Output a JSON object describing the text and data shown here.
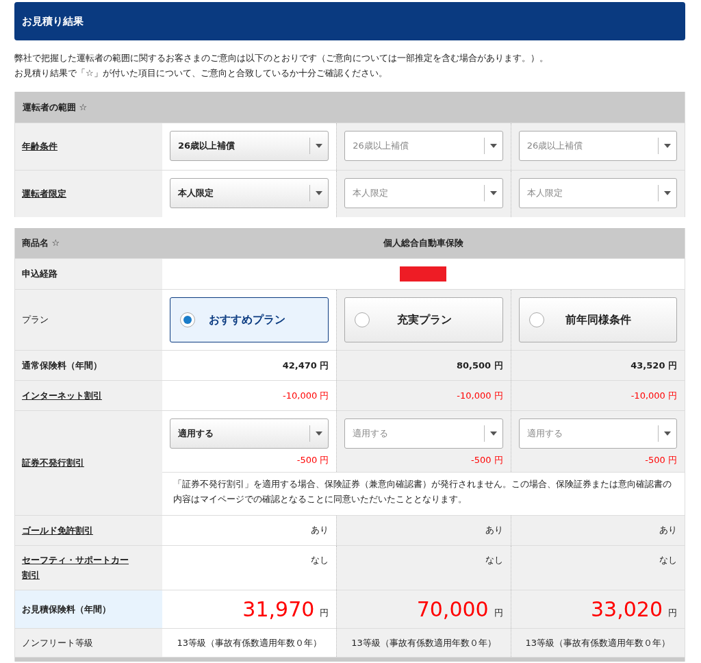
{
  "header": {
    "title": "お見積り結果"
  },
  "intro": [
    "弊社で把握した運転者の範囲に関するお客さまのご意向は以下のとおりです（ご意向については一部推定を含む場合があります。）。",
    "お見積り結果で「☆」が付いた項目について、ご意向と合致しているか十分ご確認ください。"
  ],
  "driver_section": {
    "title": "運転者の範囲 ☆",
    "rows": [
      {
        "label": "年齢条件",
        "link": true,
        "selects": [
          {
            "value": "26歳以上補償",
            "disabled": false
          },
          {
            "value": "26歳以上補償",
            "disabled": true
          },
          {
            "value": "26歳以上補償",
            "disabled": true
          }
        ]
      },
      {
        "label": "運転者限定",
        "link": true,
        "selects": [
          {
            "value": "本人限定",
            "disabled": false
          },
          {
            "value": "本人限定",
            "disabled": true
          },
          {
            "value": "本人限定",
            "disabled": true
          }
        ]
      }
    ]
  },
  "product_section": {
    "title": "商品名 ☆",
    "product": "個人総合自動車保険",
    "route_label": "申込経路",
    "plan_label": "プラン",
    "plans": [
      {
        "name": "おすすめプラン",
        "selected": true
      },
      {
        "name": "充実プラン",
        "selected": false
      },
      {
        "name": "前年同様条件",
        "selected": false
      }
    ],
    "rows": [
      {
        "kind": "amount",
        "label": "通常保険料（年間）",
        "link": false,
        "values": [
          "42,470 円",
          "80,500 円",
          "43,520 円"
        ]
      },
      {
        "kind": "discount",
        "label": "インターネット割引",
        "link": true,
        "values": [
          "-10,000 円",
          "-10,000 円",
          "-10,000 円"
        ]
      },
      {
        "kind": "select_discount",
        "label": "証券不発行割引",
        "link": true,
        "selects": [
          {
            "value": "適用する",
            "disabled": false
          },
          {
            "value": "適用する",
            "disabled": true
          },
          {
            "value": "適用する",
            "disabled": true
          }
        ],
        "values": [
          "-500 円",
          "-500 円",
          "-500 円"
        ],
        "note": "「証券不発行割引」を適用する場合、保険証券（兼意向確認書）が発行されません。この場合、保険証券または意向確認書の内容はマイページでの確認となることに同意いただいたこととなります。"
      },
      {
        "kind": "text",
        "label": "ゴールド免許割引",
        "link": true,
        "values": [
          "あり",
          "あり",
          "あり"
        ]
      },
      {
        "kind": "text",
        "label": "セーフティ・サポートカー割引",
        "link": true,
        "values": [
          "なし",
          "なし",
          "なし"
        ]
      },
      {
        "kind": "total",
        "label": "お見積保険料（年間）",
        "link": false,
        "values": [
          {
            "amount": "31,970",
            "unit": "円"
          },
          {
            "amount": "70,000",
            "unit": "円"
          },
          {
            "amount": "33,020",
            "unit": "円"
          }
        ]
      },
      {
        "kind": "grade",
        "label": "ノンフリート等級",
        "link": false,
        "values": [
          "13等級（事故有係数適用年数０年）",
          "13等級（事故有係数適用年数０年）",
          "13等級（事故有係数適用年数０年）"
        ]
      }
    ]
  }
}
